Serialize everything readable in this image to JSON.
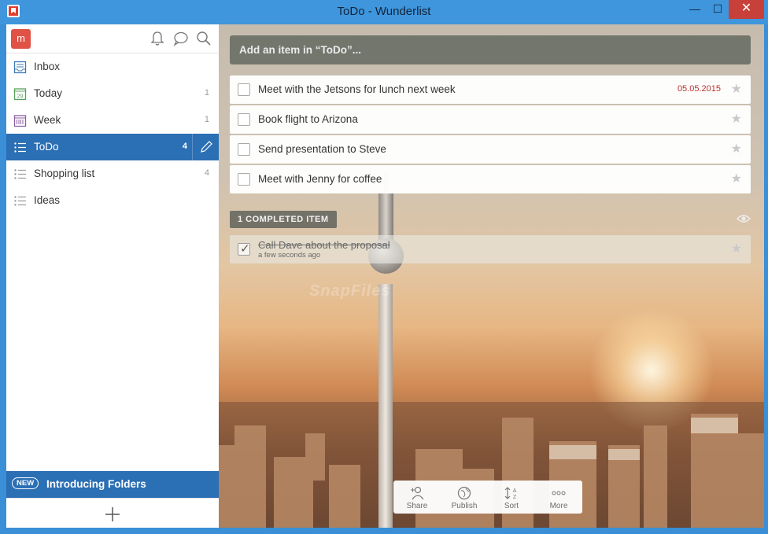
{
  "window": {
    "title": "ToDo - Wunderlist",
    "min": "—",
    "max": "☐",
    "close": "✕"
  },
  "sidebar": {
    "avatar_letter": "m",
    "lists": [
      {
        "label": "Inbox",
        "count": "",
        "icon": "inbox-icon"
      },
      {
        "label": "Today",
        "count": "1",
        "icon": "calendar-day-icon",
        "icon_text": "29"
      },
      {
        "label": "Week",
        "count": "1",
        "icon": "calendar-week-icon"
      },
      {
        "label": "ToDo",
        "count": "4",
        "icon": "list-icon",
        "active": true
      },
      {
        "label": "Shopping list",
        "count": "4",
        "icon": "list-icon"
      },
      {
        "label": "Ideas",
        "count": "",
        "icon": "list-icon"
      }
    ],
    "banner": {
      "badge": "NEW",
      "text": "Introducing Folders"
    }
  },
  "main": {
    "add_placeholder": "Add an item in “ToDo”...",
    "tasks": [
      {
        "text": "Meet with the Jetsons for lunch next week",
        "due": "05.05.2015"
      },
      {
        "text": "Book flight to Arizona",
        "due": ""
      },
      {
        "text": "Send presentation to Steve",
        "due": ""
      },
      {
        "text": "Meet with Jenny for coffee",
        "due": ""
      }
    ],
    "completed_label": "1 COMPLETED ITEM",
    "completed_task": {
      "text": "Call Dave about the proposal",
      "time": "a few seconds ago"
    },
    "watermark": "SnapFiles",
    "toolbar": {
      "share": "Share",
      "publish": "Publish",
      "sort": "Sort",
      "more": "More"
    }
  },
  "colors": {
    "accent": "#2b6fb4",
    "due_date": "#b8312a",
    "titlebar": "#3f96dc"
  }
}
